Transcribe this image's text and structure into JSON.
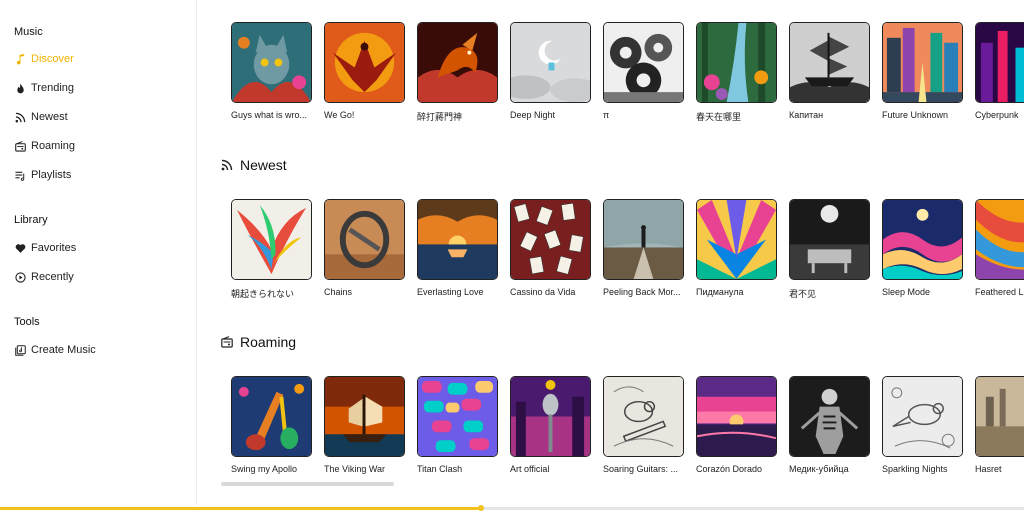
{
  "sidebar": {
    "music_heading": "Music",
    "music_items": [
      {
        "label": "Discover",
        "icon": "music-note-icon",
        "active": true
      },
      {
        "label": "Trending",
        "icon": "flame-icon"
      },
      {
        "label": "Newest",
        "icon": "rss-icon"
      },
      {
        "label": "Roaming",
        "icon": "radio-icon"
      },
      {
        "label": "Playlists",
        "icon": "playlist-icon"
      }
    ],
    "library_heading": "Library",
    "library_items": [
      {
        "label": "Favorites",
        "icon": "heart-icon"
      },
      {
        "label": "Recently",
        "icon": "play-circle-icon"
      }
    ],
    "tools_heading": "Tools",
    "tools_items": [
      {
        "label": "Create Music",
        "icon": "create-music-icon"
      }
    ]
  },
  "sections": {
    "trending": {
      "cards": [
        {
          "title": "Guys what is wro..."
        },
        {
          "title": "We Go!"
        },
        {
          "title": "醉打蔣門神"
        },
        {
          "title": "Deep Night"
        },
        {
          "title": "π"
        },
        {
          "title": "春天在哪里"
        },
        {
          "title": "Капитан"
        },
        {
          "title": "Future Unknown"
        },
        {
          "title": "Cyberpunk"
        }
      ]
    },
    "newest": {
      "title": "Newest",
      "cards": [
        {
          "title": "朝起きられない"
        },
        {
          "title": "Chains"
        },
        {
          "title": "Everlasting Love"
        },
        {
          "title": "Cassino da Vida"
        },
        {
          "title": "Peeling Back Mor..."
        },
        {
          "title": "Пидманула"
        },
        {
          "title": "君不见"
        },
        {
          "title": "Sleep Mode"
        },
        {
          "title": "Feathered L"
        }
      ]
    },
    "roaming": {
      "title": "Roaming",
      "cards": [
        {
          "title": "Swing my Apollo"
        },
        {
          "title": "The Viking War"
        },
        {
          "title": "Titan Clash"
        },
        {
          "title": "Art official"
        },
        {
          "title": "Soaring Guitars: ..."
        },
        {
          "title": "Corazón Dorado"
        },
        {
          "title": "Медик-убийца"
        },
        {
          "title": "Sparkling Nights"
        },
        {
          "title": "Hasret"
        }
      ]
    }
  },
  "player": {
    "progress": 0.47
  },
  "colors": {
    "accent": "#f0b400",
    "progress": "#f2c21a"
  }
}
